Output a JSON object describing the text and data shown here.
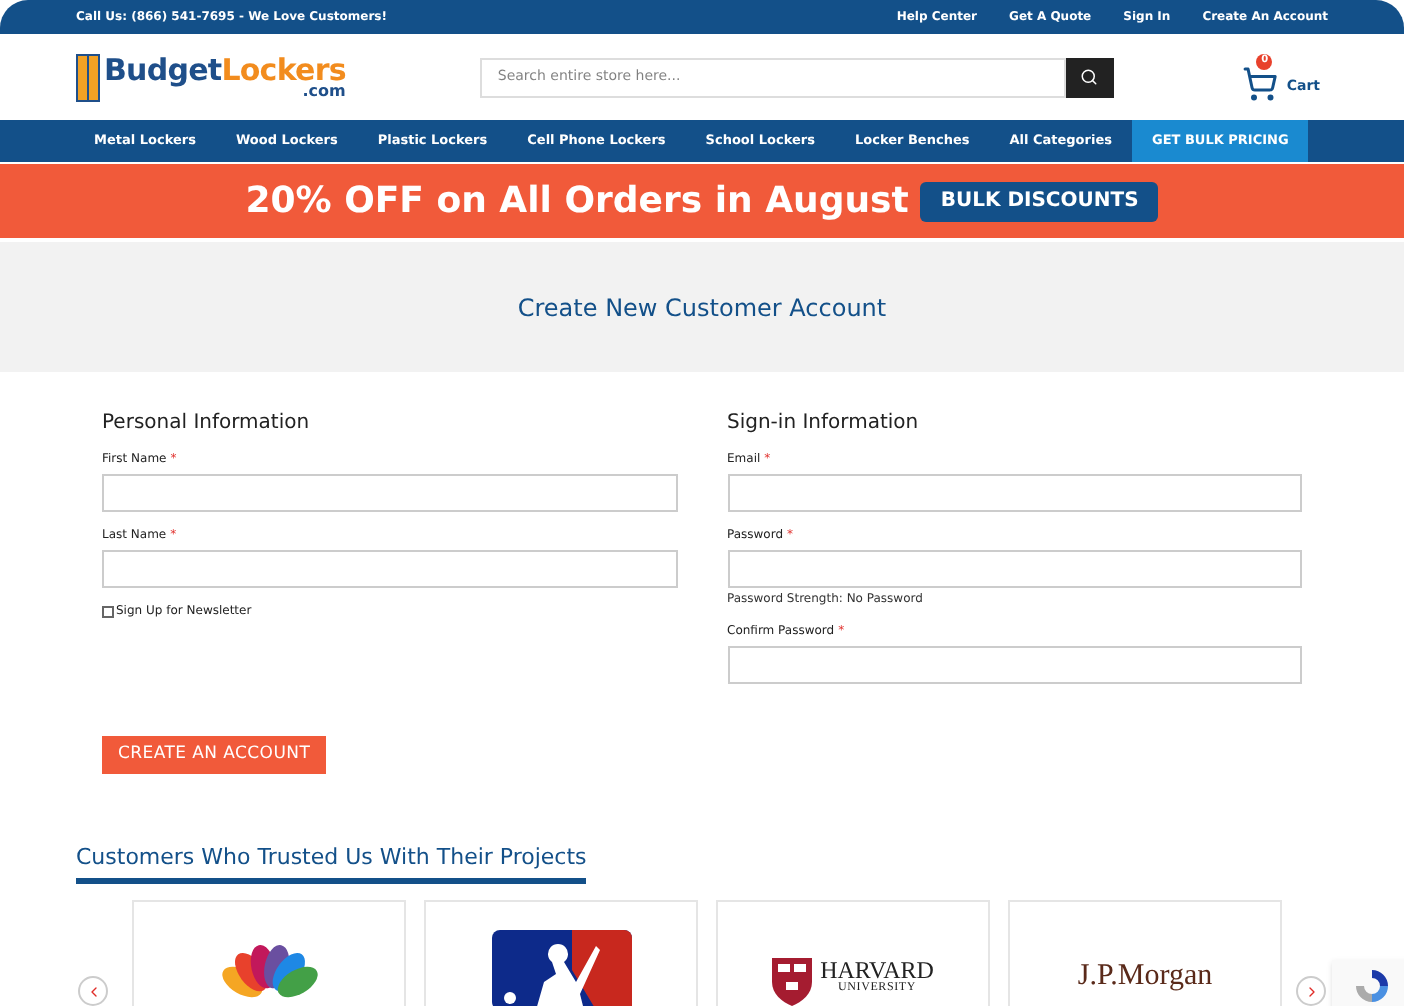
{
  "top_bar": {
    "phone": "Call Us: (866) 541-7695 - We Love Customers!",
    "links": [
      "Help Center",
      "Get A Quote",
      "Sign In",
      "Create An Account"
    ]
  },
  "header": {
    "logo": {
      "word_1": "Budget",
      "word_2": "Lockers",
      "suffix": ".com"
    },
    "search": {
      "placeholder": "Search entire store here..."
    },
    "cart": {
      "label": "Cart",
      "count": "0"
    }
  },
  "nav": [
    {
      "label": "Metal Lockers",
      "highlighted": false
    },
    {
      "label": "Wood Lockers",
      "highlighted": false
    },
    {
      "label": "Plastic Lockers",
      "highlighted": false
    },
    {
      "label": "Cell Phone Lockers",
      "highlighted": false
    },
    {
      "label": "School Lockers",
      "highlighted": false
    },
    {
      "label": "Locker Benches",
      "highlighted": false
    },
    {
      "label": "All Categories",
      "highlighted": false
    },
    {
      "label": "GET BULK PRICING",
      "highlighted": true
    }
  ],
  "promo": {
    "text": "20% OFF on All Orders in August",
    "button": "BULK DISCOUNTS"
  },
  "page_title": "Create New Customer Account",
  "sections": [
    {
      "title": "Personal Information",
      "fields": [
        {
          "label": "First Name",
          "required_mark": "*"
        },
        {
          "label": "Last Name",
          "required_mark": "*"
        }
      ],
      "checkbox": {
        "label": "Sign Up for Newsletter",
        "checked": false
      }
    },
    {
      "title": "Sign-in Information",
      "fields": [
        {
          "label": "Email",
          "required_mark": "*"
        },
        {
          "label": "Password",
          "required_mark": "*",
          "note": "Password Strength: No Password"
        },
        {
          "label": "Confirm Password",
          "required_mark": "*"
        }
      ]
    }
  ],
  "submit": "CREATE AN ACCOUNT",
  "customers": {
    "title": "Customers Who Trusted Us With Their Projects",
    "logos": [
      {
        "kind": "peacock"
      },
      {
        "kind": "batter"
      },
      {
        "kind": "shield",
        "line_1": "HARVARD",
        "line_2": "UNIVERSITY"
      },
      {
        "kind": "wordmark",
        "text": "J.P.Morgan"
      }
    ]
  }
}
